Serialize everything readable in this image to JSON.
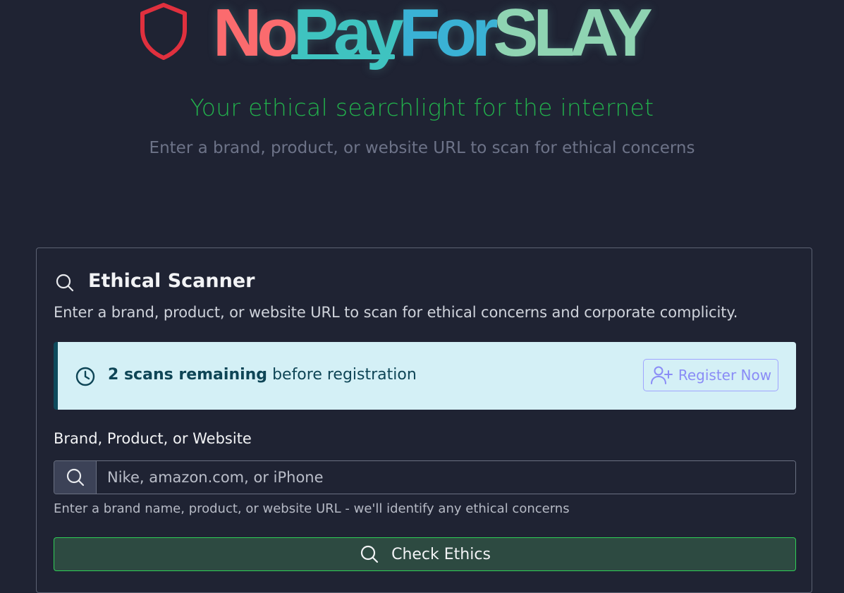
{
  "hero": {
    "logo_part1": "No",
    "logo_part2": "Pay",
    "logo_part3": "For",
    "logo_part4": "SLAY",
    "tagline": "Your ethical searchlight for the internet",
    "subtitle": "Enter a brand, product, or website URL to scan for ethical concerns"
  },
  "scanner": {
    "title": "Ethical Scanner",
    "description": "Enter a brand, product, or website URL to scan for ethical concerns and corporate complicity.",
    "alert": {
      "count_text": "2 scans remaining",
      "suffix_text": "before registration",
      "register_label": "Register Now"
    },
    "field_label": "Brand, Product, or Website",
    "input_value": "",
    "input_placeholder": "Nike, amazon.com, or iPhone",
    "help_text": "Enter a brand name, product, or website URL - we'll identify any ethical concerns",
    "submit_label": "Check Ethics"
  },
  "icons": {
    "logo": "shield-icon",
    "scanner_title": "search-icon",
    "alert": "clock-icon",
    "register": "user-plus-icon",
    "input_addon": "search-icon",
    "submit": "search-icon"
  },
  "colors": {
    "background": "#1f2333",
    "logo_no": "#fb6b6e",
    "logo_pay": "#3fc3c0",
    "logo_for": "#3ab2d5",
    "logo_slay": "#8fd4b2",
    "tagline": "#22b14c",
    "alert_background": "#d4f0f6",
    "register_accent": "#8a8cf6",
    "submit_background": "#2d4a41",
    "submit_border": "#2fcf56"
  }
}
